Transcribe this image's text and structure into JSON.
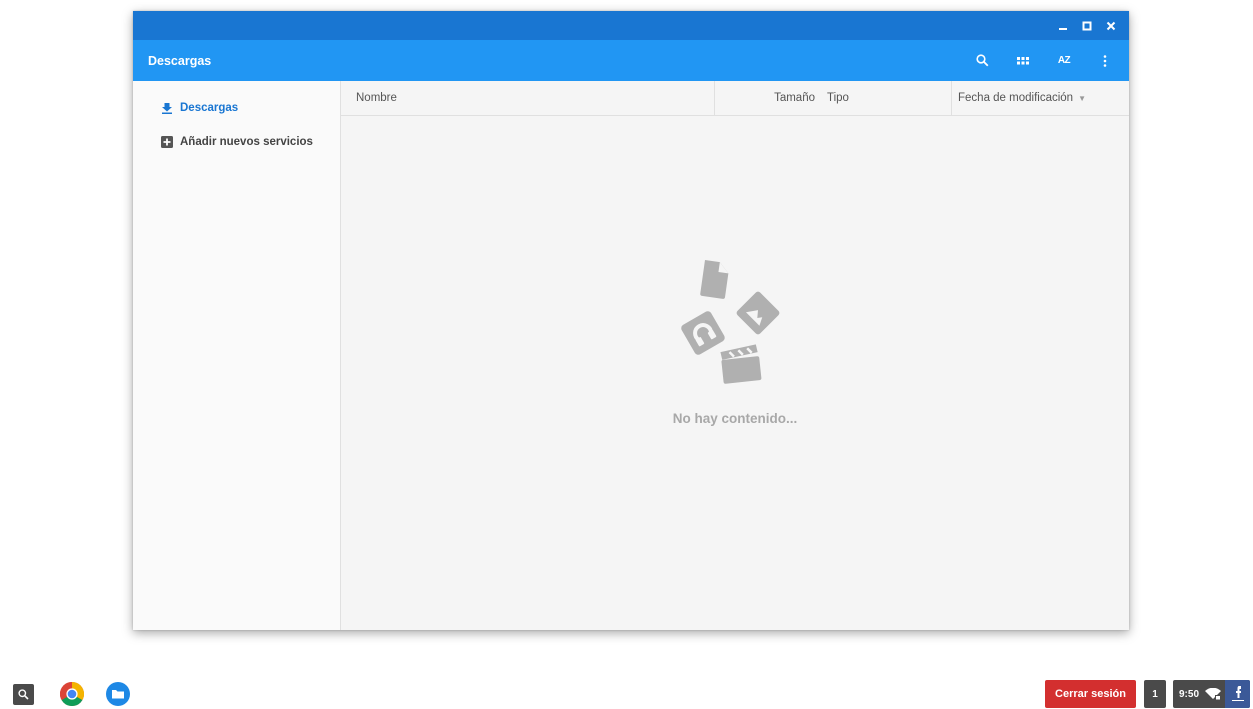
{
  "window": {
    "title": "Descargas",
    "controls": [
      "minimize-icon",
      "maximize-icon",
      "close-icon"
    ]
  },
  "toolbar": {
    "icons": [
      "search-icon",
      "grid-view-icon",
      "sort-az-icon",
      "more-vert-icon"
    ],
    "sort_label": "AZ"
  },
  "sidebar": {
    "items": [
      {
        "label": "Descargas",
        "icon": "download-icon",
        "active": true
      },
      {
        "label": "Añadir nuevos servicios",
        "icon": "add-box-icon",
        "active": false
      }
    ]
  },
  "table": {
    "columns": [
      "Nombre",
      "Tamaño",
      "Tipo",
      "Fecha de modificación"
    ],
    "rows": []
  },
  "empty_state": {
    "message": "No hay contenido..."
  },
  "shelf": {
    "apps": [
      "launcher-search-icon",
      "chrome-icon",
      "files-app-icon"
    ],
    "logout_label": "Cerrar sesión",
    "notification_count": "1",
    "clock": "9:50"
  },
  "colors": {
    "titlebar": "#1976d2",
    "appbar": "#2196f3",
    "accent": "#1976d2",
    "logout": "#d32f2f",
    "shelf_item": "#4a4a4a",
    "empty_art": "#b0b0b0"
  }
}
